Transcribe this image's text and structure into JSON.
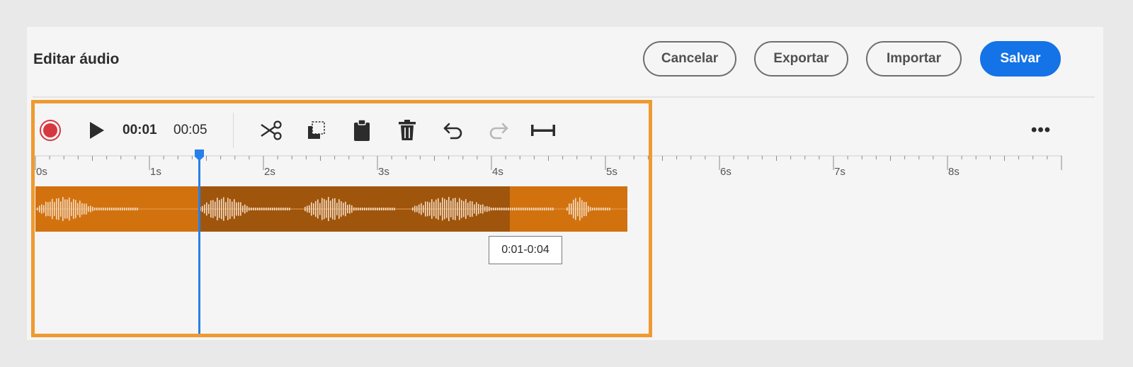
{
  "header": {
    "title": "Editar áudio",
    "cancel_label": "Cancelar",
    "export_label": "Exportar",
    "import_label": "Importar",
    "save_label": "Salvar"
  },
  "toolbar": {
    "current_time": "00:01",
    "total_time": "00:05",
    "icons": [
      "record-icon",
      "play-icon",
      "cut-icon",
      "copy-icon",
      "paste-icon",
      "delete-icon",
      "undo-icon",
      "redo-icon",
      "fit-width-icon"
    ],
    "more_label": "•••"
  },
  "timeline": {
    "tick_labels": [
      "0s",
      "1s",
      "2s",
      "3s",
      "4s",
      "5s",
      "6s",
      "7s",
      "8s"
    ]
  },
  "selection": {
    "range_label": "0:01-0:04"
  },
  "colors": {
    "accent": "#1473e6",
    "track": "#d2720f",
    "track_selected": "#a0550d",
    "highlight_frame": "#ef9a30",
    "playhead": "#2680eb",
    "record": "#d7373f"
  }
}
